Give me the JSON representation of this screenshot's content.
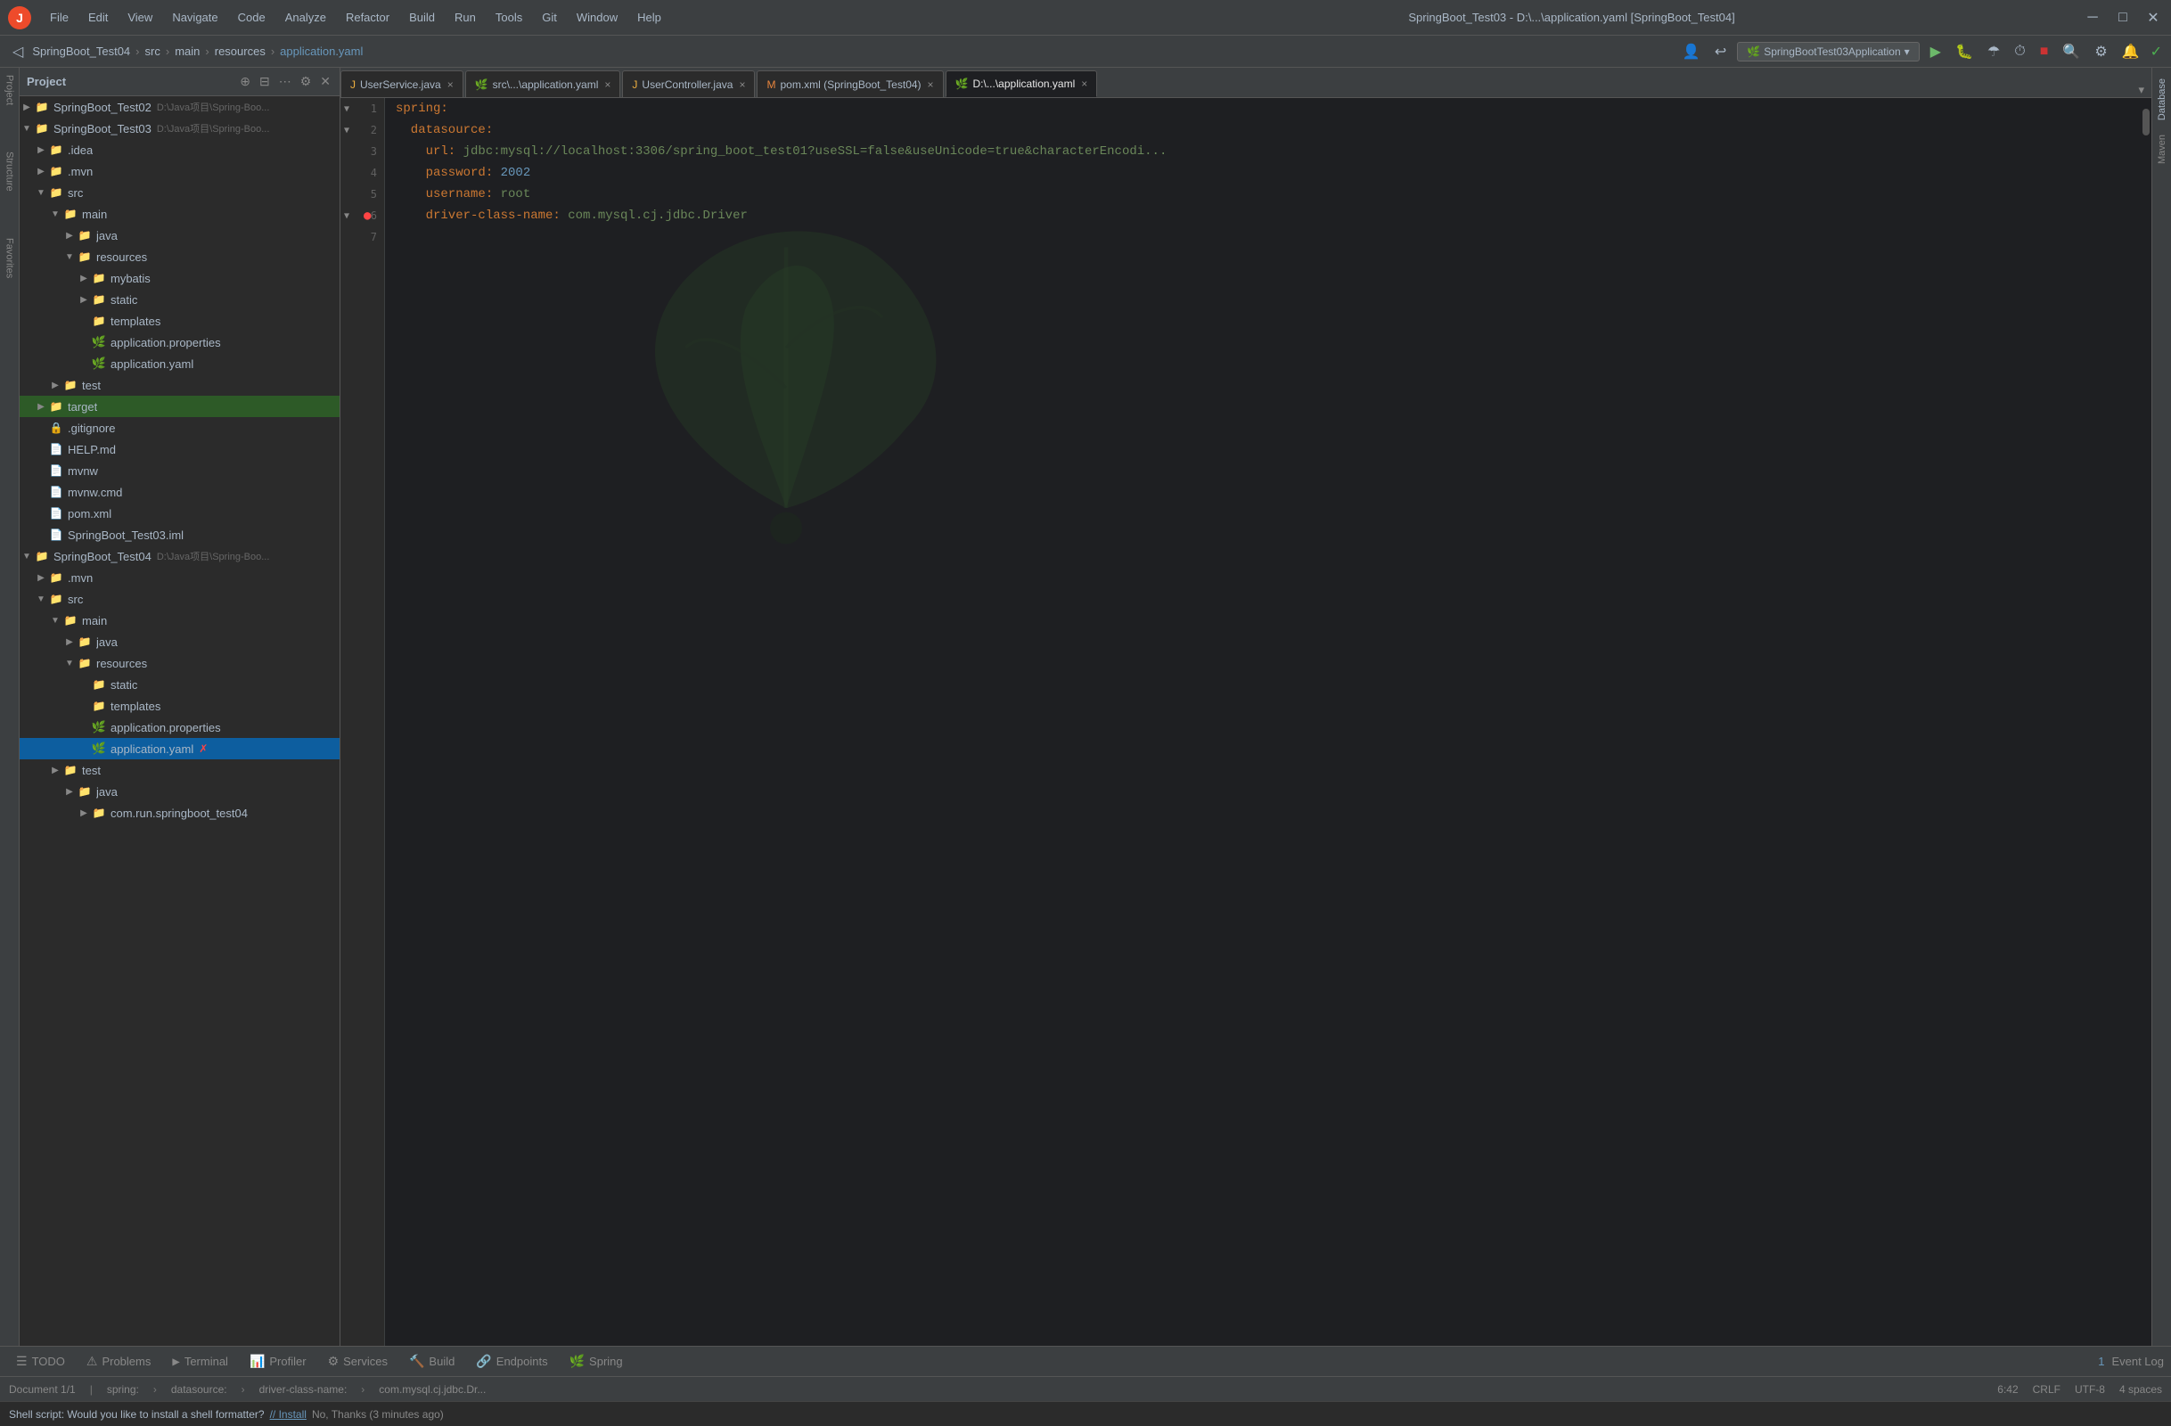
{
  "window": {
    "title": "SpringBoot_Test03 - D:\\...\\application.yaml [SpringBoot_Test04]"
  },
  "menu": {
    "items": [
      "File",
      "Edit",
      "View",
      "Navigate",
      "Code",
      "Analyze",
      "Refactor",
      "Build",
      "Run",
      "Tools",
      "Git",
      "Window",
      "Help"
    ]
  },
  "breadcrumb": {
    "items": [
      "SpringBoot_Test04",
      "src",
      "main",
      "resources",
      "application.yaml"
    ]
  },
  "run_config": {
    "label": "SpringBootTest03Application",
    "dropdown": "▾"
  },
  "tabs": [
    {
      "label": "UserService.java",
      "icon": "J",
      "close": "×",
      "active": false
    },
    {
      "label": "src\\...\\application.yaml",
      "icon": "Y",
      "close": "×",
      "active": false
    },
    {
      "label": "UserController.java",
      "icon": "J",
      "close": "×",
      "active": false
    },
    {
      "label": "pom.xml (SpringBoot_Test04)",
      "icon": "M",
      "close": "×",
      "active": false
    },
    {
      "label": "D:\\...\\application.yaml",
      "icon": "Y",
      "close": "×",
      "active": true
    }
  ],
  "editor": {
    "filename": "application.yaml",
    "lines": [
      {
        "num": "1",
        "content": "spring:",
        "tokens": [
          {
            "text": "spring:",
            "cls": "kw-key"
          }
        ]
      },
      {
        "num": "2",
        "content": "  datasource:",
        "indent": "  ",
        "tokens": [
          {
            "text": "  datasource:",
            "cls": "kw-key"
          }
        ]
      },
      {
        "num": "3",
        "content": "    url: jdbc:mysql://localhost:3306/spring_boot_test01?useSSL=false&useUnicode=true&characterEncodi...",
        "tokens": [
          {
            "text": "    url: ",
            "cls": "kw-key"
          },
          {
            "text": "jdbc:mysql://localhost:3306/spring_boot_test01?useSSL=false&useUnicode=true&characterEncodi...",
            "cls": "kw-str"
          }
        ]
      },
      {
        "num": "4",
        "content": "    password: 2002",
        "tokens": [
          {
            "text": "    password: ",
            "cls": "kw-key"
          },
          {
            "text": "2002",
            "cls": "kw-num"
          }
        ]
      },
      {
        "num": "5",
        "content": "    username: root",
        "tokens": [
          {
            "text": "    username: ",
            "cls": "kw-key"
          },
          {
            "text": "root",
            "cls": "kw-str"
          }
        ]
      },
      {
        "num": "6",
        "content": "    driver-class-name: com.mysql.cj.jdbc.Driver",
        "hasError": true,
        "tokens": [
          {
            "text": "    driver-class-name: ",
            "cls": "kw-key"
          },
          {
            "text": "com.mysql.cj.jdbc.Driver",
            "cls": "kw-str"
          }
        ]
      },
      {
        "num": "7",
        "content": "",
        "tokens": []
      }
    ]
  },
  "project_tree": {
    "title": "Project",
    "items": [
      {
        "id": "springboot_test02",
        "label": "SpringBoot_Test02",
        "sublabel": "D:\\Java项目\\Spring-Boo...",
        "indent": 0,
        "type": "folder-project",
        "arrow": "▶",
        "expanded": false
      },
      {
        "id": "springboot_test03",
        "label": "SpringBoot_Test03",
        "sublabel": "D:\\Java项目\\Spring-Boo...",
        "indent": 0,
        "type": "folder-project",
        "arrow": "▼",
        "expanded": true
      },
      {
        "id": "test03_idea",
        "label": ".idea",
        "indent": 1,
        "type": "folder",
        "arrow": "▶",
        "expanded": false
      },
      {
        "id": "test03_mvn",
        "label": ".mvn",
        "indent": 1,
        "type": "folder",
        "arrow": "▶",
        "expanded": false
      },
      {
        "id": "test03_src",
        "label": "src",
        "indent": 1,
        "type": "folder-src",
        "arrow": "▼",
        "expanded": true
      },
      {
        "id": "test03_main",
        "label": "main",
        "indent": 2,
        "type": "folder",
        "arrow": "▼",
        "expanded": true
      },
      {
        "id": "test03_java",
        "label": "java",
        "indent": 3,
        "type": "folder-java",
        "arrow": "▶",
        "expanded": false
      },
      {
        "id": "test03_resources",
        "label": "resources",
        "indent": 3,
        "type": "folder-res",
        "arrow": "▼",
        "expanded": true
      },
      {
        "id": "test03_mybatis",
        "label": "mybatis",
        "indent": 4,
        "type": "folder",
        "arrow": "▶",
        "expanded": false
      },
      {
        "id": "test03_static",
        "label": "static",
        "indent": 4,
        "type": "folder",
        "arrow": "▶",
        "expanded": false
      },
      {
        "id": "test03_templates",
        "label": "templates",
        "indent": 4,
        "type": "folder",
        "arrow": "",
        "expanded": false
      },
      {
        "id": "test03_app_props",
        "label": "application.properties",
        "indent": 4,
        "type": "properties",
        "arrow": ""
      },
      {
        "id": "test03_app_yaml",
        "label": "application.yaml",
        "indent": 4,
        "type": "yaml",
        "arrow": ""
      },
      {
        "id": "test03_test",
        "label": "test",
        "indent": 2,
        "type": "folder",
        "arrow": "▶",
        "expanded": false
      },
      {
        "id": "test03_target",
        "label": "target",
        "indent": 1,
        "type": "folder",
        "arrow": "▶",
        "expanded": false,
        "selected": false
      },
      {
        "id": "test03_gitignore",
        "label": ".gitignore",
        "indent": 1,
        "type": "git",
        "arrow": ""
      },
      {
        "id": "test03_help",
        "label": "HELP.md",
        "indent": 1,
        "type": "md",
        "arrow": ""
      },
      {
        "id": "test03_mvnw",
        "label": "mvnw",
        "indent": 1,
        "type": "cmd",
        "arrow": ""
      },
      {
        "id": "test03_mvnw_cmd",
        "label": "mvnw.cmd",
        "indent": 1,
        "type": "cmd",
        "arrow": ""
      },
      {
        "id": "test03_pom",
        "label": "pom.xml",
        "indent": 1,
        "type": "xml",
        "arrow": ""
      },
      {
        "id": "test03_iml",
        "label": "SpringBoot_Test03.iml",
        "indent": 1,
        "type": "iml",
        "arrow": ""
      },
      {
        "id": "springboot_test04",
        "label": "SpringBoot_Test04",
        "sublabel": "D:\\Java项目\\Spring-Boo...",
        "indent": 0,
        "type": "folder-project",
        "arrow": "▼",
        "expanded": true
      },
      {
        "id": "test04_mvn",
        "label": ".mvn",
        "indent": 1,
        "type": "folder",
        "arrow": "▶",
        "expanded": false
      },
      {
        "id": "test04_src",
        "label": "src",
        "indent": 1,
        "type": "folder-src",
        "arrow": "▼",
        "expanded": true
      },
      {
        "id": "test04_main",
        "label": "main",
        "indent": 2,
        "type": "folder",
        "arrow": "▼",
        "expanded": true
      },
      {
        "id": "test04_java",
        "label": "java",
        "indent": 3,
        "type": "folder-java",
        "arrow": "▶",
        "expanded": false
      },
      {
        "id": "test04_resources",
        "label": "resources",
        "indent": 3,
        "type": "folder-res",
        "arrow": "▼",
        "expanded": true
      },
      {
        "id": "test04_static",
        "label": "static",
        "indent": 4,
        "type": "folder",
        "arrow": ""
      },
      {
        "id": "test04_templates",
        "label": "templates",
        "indent": 4,
        "type": "folder",
        "arrow": ""
      },
      {
        "id": "test04_app_props",
        "label": "application.properties",
        "indent": 4,
        "type": "properties",
        "arrow": ""
      },
      {
        "id": "test04_app_yaml",
        "label": "application.yaml",
        "indent": 4,
        "type": "yaml",
        "arrow": "",
        "selected": true
      },
      {
        "id": "test04_test",
        "label": "test",
        "indent": 2,
        "type": "folder",
        "arrow": "▶",
        "expanded": false
      },
      {
        "id": "test04_test_java",
        "label": "java",
        "indent": 3,
        "type": "folder-java",
        "arrow": "▶",
        "expanded": false
      },
      {
        "id": "test04_com",
        "label": "com.run.springboot_test04",
        "indent": 4,
        "type": "folder-java",
        "arrow": "▶",
        "expanded": false
      }
    ]
  },
  "bottom_tabs": [
    {
      "id": "todo",
      "label": "TODO",
      "icon": "☰"
    },
    {
      "id": "problems",
      "label": "Problems",
      "icon": "⚠"
    },
    {
      "id": "terminal",
      "label": "Terminal",
      "icon": ">"
    },
    {
      "id": "profiler",
      "label": "Profiler",
      "icon": "📊"
    },
    {
      "id": "services",
      "label": "Services",
      "icon": "⚙"
    },
    {
      "id": "build",
      "label": "Build",
      "icon": "🔨"
    },
    {
      "id": "endpoints",
      "label": "Endpoints",
      "icon": "🔗"
    },
    {
      "id": "spring",
      "label": "Spring",
      "icon": "🌿"
    }
  ],
  "status_bar": {
    "doc_info": "Document 1/1",
    "spring_label": "spring:",
    "datasource_label": "datasource:",
    "driver_label": "driver-class-name:",
    "driver_value": "com.mysql.cj.jdbc.Dr...",
    "right": {
      "line_col": "6:42",
      "crlf": "CRLF",
      "encoding": "UTF-8",
      "spaces": "4 spaces"
    }
  },
  "shell_bar": {
    "text": "Shell script: Would you like to install a shell formatter?",
    "install_label": "// Install",
    "no_thanks": "No, Thanks (3 minutes ago)"
  },
  "right_tabs": [
    "Database",
    "Maven"
  ],
  "left_tabs": [
    "Project",
    "Structure",
    "Favorites"
  ]
}
